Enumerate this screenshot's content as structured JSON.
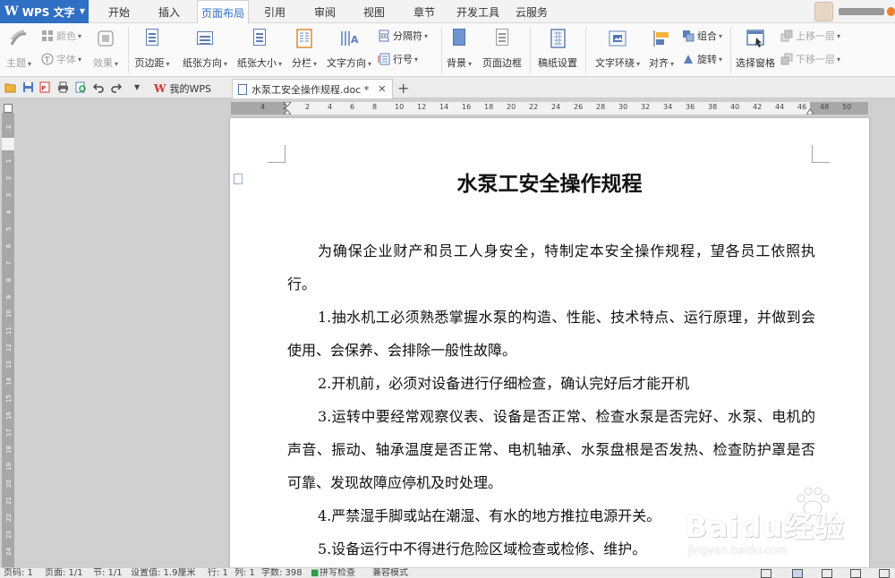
{
  "app": {
    "name": "WPS 文字",
    "accent": "#2f6fc4"
  },
  "menu_tabs": [
    "开始",
    "插入",
    "页面布局",
    "引用",
    "审阅",
    "视图",
    "章节",
    "开发工具",
    "云服务"
  ],
  "active_menu_tab": "页面布局",
  "ribbon": {
    "theme_label": "主题",
    "color_label": "颜色",
    "font_label": "字体",
    "effect_label": "效果",
    "margin_label": "页边距",
    "orientation_label": "纸张方向",
    "size_label": "纸张大小",
    "columns_label": "分栏",
    "text_direction_label": "文字方向",
    "separator_label": "分隔符",
    "line_number_label": "行号",
    "background_label": "背景",
    "page_border_label": "页面边框",
    "manuscript_label": "稿纸设置",
    "wrap_label": "文字环绕",
    "align_label": "对齐",
    "group_label": "组合",
    "rotate_label": "旋转",
    "selection_pane_label": "选择窗格",
    "bring_forward_label": "上移一层",
    "send_backward_label": "下移一层"
  },
  "tabs": {
    "home_tab": "我的WPS",
    "doc_tab": "水泵工安全操作规程.doc *"
  },
  "ruler": {
    "h_ticks": [
      "4",
      "2",
      "2",
      "4",
      "6",
      "8",
      "10",
      "12",
      "14",
      "16",
      "18",
      "20",
      "22",
      "24",
      "26",
      "28",
      "30",
      "32",
      "34",
      "36",
      "38",
      "40",
      "42",
      "44",
      "46",
      "48",
      "50"
    ],
    "v_ticks": [
      "2",
      "1",
      "1",
      "2",
      "3",
      "4",
      "5",
      "6",
      "7",
      "8",
      "9",
      "10",
      "11",
      "12",
      "13",
      "14",
      "15",
      "16",
      "17",
      "18",
      "19",
      "20",
      "21",
      "22",
      "23",
      "24"
    ]
  },
  "document": {
    "title": "水泵工安全操作规程",
    "paragraphs": [
      "为确保企业财产和员工人身安全，特制定本安全操作规程，望各员工依照执行。",
      "1.抽水机工必须熟悉掌握水泵的构造、性能、技术特点、运行原理，并做到会使用、会保养、会排除一般性故障。",
      "2.开机前，必须对设备进行仔细检查，确认完好后才能开机",
      "3.运转中要经常观察仪表、设备是否正常、检查水泵是否完好、水泵、电机的声音、振动、轴承温度是否正常、电机轴承、水泵盘根是否发热、检查防护罩是否可靠、发现故障应停机及时处理。",
      "4.严禁湿手脚或站在潮湿、有水的地方推拉电源开关。",
      "5.设备运行中不得进行危险区域检查或检修、维护。"
    ]
  },
  "watermark": {
    "main": "Baidu经验",
    "sub": "jingyan.baidu.com"
  },
  "status": {
    "page_no": "页码: 1",
    "pages": "页面: 1/1",
    "section": "节: 1/1",
    "setting": "设置值: 1.9厘米",
    "row": "行: 1",
    "col": "列: 1",
    "words": "字数: 398",
    "spell": "拼写检查",
    "compat": "兼容模式"
  }
}
